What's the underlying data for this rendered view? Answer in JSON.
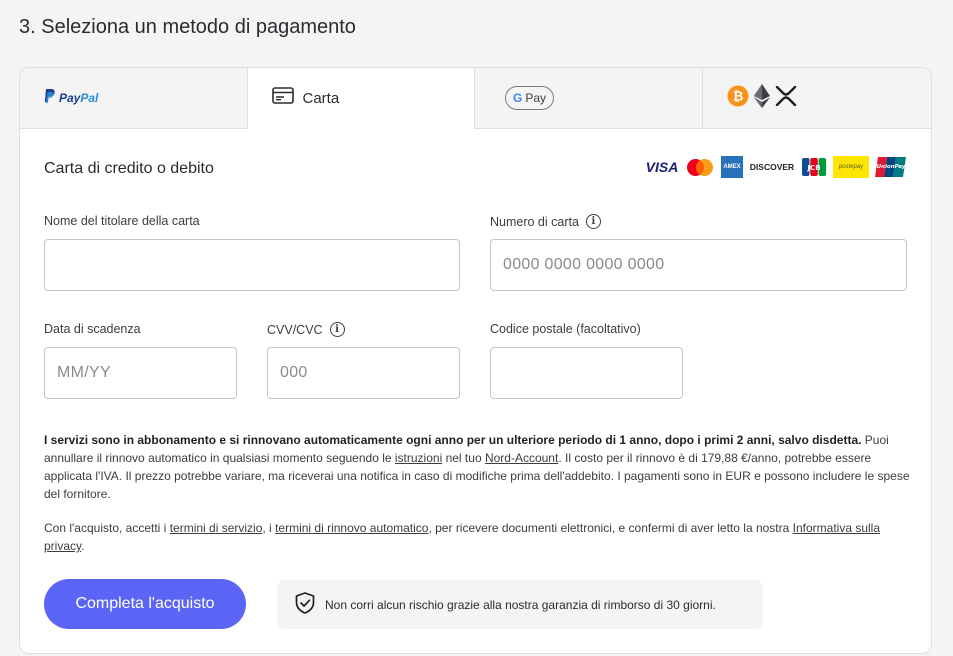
{
  "section_title": "3. Seleziona un metodo di pagamento",
  "tabs": {
    "paypal": {
      "label_pay": "Pay",
      "label_pal": "Pal"
    },
    "card": {
      "label": "Carta"
    },
    "gpay": {
      "label": "Pay",
      "g": "G"
    },
    "crypto": {
      "icons": [
        "bitcoin-icon",
        "ethereum-icon",
        "xrp-icon"
      ]
    }
  },
  "card_form": {
    "heading": "Carta di credito o debito",
    "brands": [
      "VISA",
      "Mastercard",
      "AMEX",
      "DISCOVER",
      "JCB",
      "postepay",
      "UnionPay"
    ],
    "holder_label": "Nome del titolare della carta",
    "holder_value": "",
    "number_label": "Numero di carta",
    "number_placeholder": "0000 0000 0000 0000",
    "expiry_label": "Data di scadenza",
    "expiry_placeholder": "MM/YY",
    "cvv_label": "CVV/CVC",
    "cvv_placeholder": "000",
    "postal_label": "Codice postale (facoltativo)",
    "postal_value": ""
  },
  "legal": {
    "bold": "I servizi sono in abbonamento e si rinnovano automaticamente ogni anno per un ulteriore periodo di 1 anno, dopo i primi 2 anni, salvo disdetta.",
    "text1": " Puoi annullare il rinnovo automatico in qualsiasi momento seguendo le ",
    "link_istruzioni": "istruzioni",
    "text2": " nel tuo ",
    "link_account": "Nord-Account",
    "text3": ". Il costo per il rinnovo è di 179,88 €/anno, potrebbe essere applicata l'IVA. Il prezzo potrebbe variare, ma riceverai una notifica in caso di modifiche prima dell'addebito. I pagamenti sono in EUR e possono includere le spese del fornitore."
  },
  "legal2": {
    "text1": "Con l'acquisto, accetti i ",
    "link_terms": "termini di servizio",
    "text2": ", i ",
    "link_renewal": "termini di rinnovo automatico",
    "text3": ", per ricevere documenti elettronici, e confermi di aver letto la nostra ",
    "link_privacy": "Informativa sulla privacy",
    "text4": "."
  },
  "purchase_button": "Completa l'acquisto",
  "guarantee": "Non corri alcun rischio grazie alla nostra garanzia di rimborso di 30 giorni.",
  "colors": {
    "accent": "#5a64f5",
    "bitcoin": "#f7931a"
  }
}
